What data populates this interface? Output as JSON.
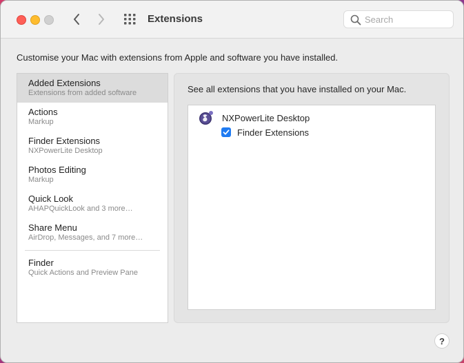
{
  "window": {
    "title": "Extensions",
    "search_placeholder": "Search"
  },
  "description": "Customise your Mac with extensions from Apple and software you have installed.",
  "sidebar": {
    "items": [
      {
        "title": "Added Extensions",
        "subtitle": "Extensions from added software",
        "selected": true
      },
      {
        "title": "Actions",
        "subtitle": "Markup"
      },
      {
        "title": "Finder Extensions",
        "subtitle": "NXPowerLite Desktop"
      },
      {
        "title": "Photos Editing",
        "subtitle": "Markup"
      },
      {
        "title": "Quick Look",
        "subtitle": "AHAPQuickLook and 3 more…"
      },
      {
        "title": "Share Menu",
        "subtitle": "AirDrop, Messages, and 7 more…"
      },
      {
        "title": "Finder",
        "subtitle": "Quick Actions and Preview Pane"
      }
    ]
  },
  "panel": {
    "text": "See all extensions that you have installed on your Mac.",
    "app_name": "NXPowerLite Desktop",
    "extension_label": "Finder Extensions",
    "extension_checked": true
  },
  "help_label": "?",
  "colors": {
    "accent": "#1f7bf2",
    "close": "#fe5f57",
    "minimize": "#febc2e"
  },
  "icons": [
    "back-chevron-icon",
    "forward-chevron-icon",
    "grid-icon",
    "search-icon",
    "nxpowerlite-app-icon",
    "checkmark-icon"
  ]
}
